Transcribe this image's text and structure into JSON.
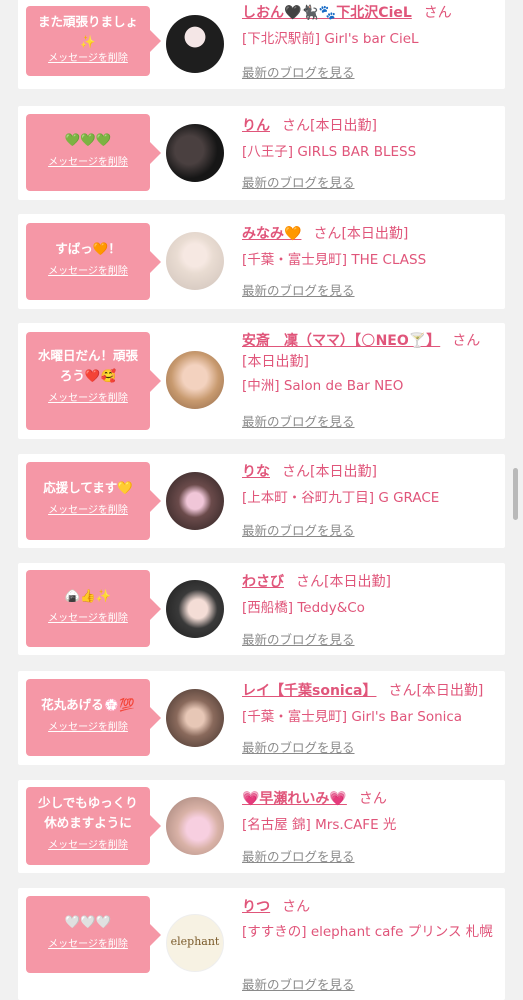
{
  "delete_label": "メッセージを削除",
  "blog_label": "最新のブログを見る",
  "san_label": "さん",
  "entries": [
    {
      "message": "また頑張りましょ\n✨",
      "name": "しおん🖤🐈‍⬛🐾下北沢CieL",
      "status": "",
      "shop": "[下北沢駅前] Girl's bar CieL"
    },
    {
      "message": "💚💚💚",
      "name": "りん",
      "status": "[本日出勤]",
      "shop": "[八王子] GIRLS BAR BLESS"
    },
    {
      "message": "すばっ🧡！",
      "name": "みなみ🧡",
      "status": "[本日出勤]",
      "shop": "[千葉・富士見町] THE CLASS"
    },
    {
      "message": "水曜日だん！頑張\nろう❤️🥰",
      "name": "安斎　凜（ママ）【🌕NEO🍸】",
      "status": "[本日出勤]",
      "shop": "[中洲] Salon de Bar NEO"
    },
    {
      "message": "応援してます💛",
      "name": "りな",
      "status": "[本日出勤]",
      "shop": "[上本町・谷町九丁目] G GRACE"
    },
    {
      "message": "🍙👍✨",
      "name": "わさび",
      "status": "[本日出勤]",
      "shop": "[西船橋] Teddy&Co"
    },
    {
      "message": "花丸あげる💮💯",
      "name": "レイ【千葉sonica】",
      "status": "[本日出勤]",
      "shop": "[千葉・富士見町] Girl's Bar Sonica"
    },
    {
      "message": "少しでもゆっくり\n休めますように",
      "name": "💗早瀬れいみ💗",
      "status": "",
      "shop": "[名古屋 錦] Mrs.CAFE 光"
    },
    {
      "message": "🤍🤍🤍",
      "name": "りつ",
      "status": "",
      "shop": "[すすきの] elephant cafe プリンス 札幌"
    }
  ],
  "avatar_logo_text": "elephant"
}
